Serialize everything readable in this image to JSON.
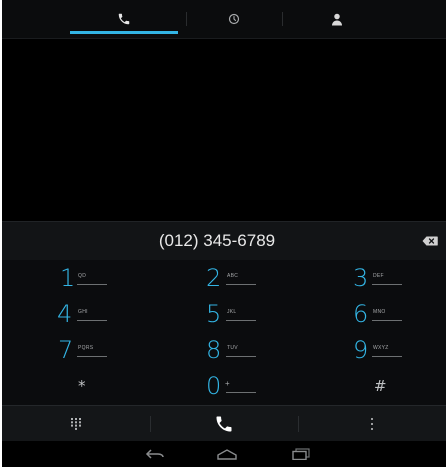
{
  "tabs": [
    {
      "id": "phone",
      "icon": "phone-icon",
      "selected": true
    },
    {
      "id": "recent",
      "icon": "clock-icon",
      "selected": false
    },
    {
      "id": "contacts",
      "icon": "person-icon",
      "selected": false
    }
  ],
  "display": {
    "number": "(012) 345-6789"
  },
  "keypad": {
    "keys": [
      {
        "digit": "1",
        "letters": "QD"
      },
      {
        "digit": "2",
        "letters": "ABC"
      },
      {
        "digit": "3",
        "letters": "DEF"
      },
      {
        "digit": "4",
        "letters": "GHI"
      },
      {
        "digit": "5",
        "letters": "JKL"
      },
      {
        "digit": "6",
        "letters": "MNO"
      },
      {
        "digit": "7",
        "letters": "PQRS"
      },
      {
        "digit": "8",
        "letters": "TUV"
      },
      {
        "digit": "9",
        "letters": "WXYZ"
      },
      {
        "digit": "0",
        "letters": "+"
      }
    ],
    "star": "*",
    "hash": "#"
  },
  "actionbar": {
    "left_icon": "dialpad-icon",
    "center_icon": "call-icon",
    "right_icon": "overflow-menu-icon"
  },
  "colors": {
    "accent": "#33b5e5",
    "background": "#000000",
    "call_icon": "#ffffff"
  }
}
